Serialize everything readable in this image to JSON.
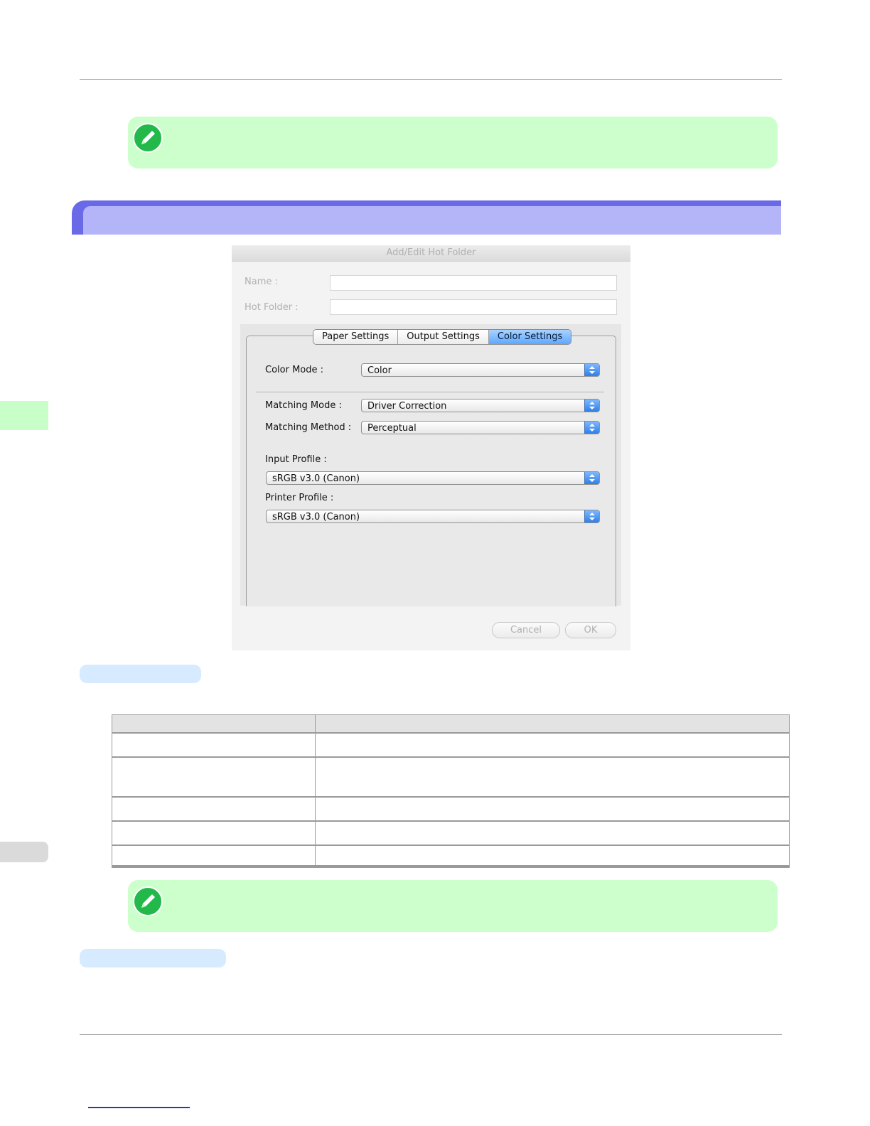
{
  "dialog": {
    "title": "Add/Edit Hot Folder",
    "name_label": "Name :",
    "hot_folder_label": "Hot Folder :",
    "name_value": "",
    "hot_folder_value": "",
    "tabs": [
      {
        "label": "Paper Settings",
        "active": false
      },
      {
        "label": "Output Settings",
        "active": false
      },
      {
        "label": "Color Settings",
        "active": true
      }
    ],
    "color_mode_label": "Color Mode :",
    "color_mode_value": "Color",
    "matching_mode_label": "Matching Mode :",
    "matching_mode_value": "Driver Correction",
    "matching_method_label": "Matching Method :",
    "matching_method_value": "Perceptual",
    "input_profile_label": "Input Profile :",
    "input_profile_value": "sRGB v3.0 (Canon)",
    "printer_profile_label": "Printer Profile :",
    "printer_profile_value": "sRGB v3.0 (Canon)",
    "cancel_label": "Cancel",
    "ok_label": "OK"
  },
  "colors": {
    "note_bg": "#ccffcc",
    "section_bar": "#6a6ae8",
    "section_bar_inner": "#b4b4f8",
    "subheading_bg": "#d6ebff",
    "active_tab": "#5ea9ff"
  },
  "icons": {
    "note": "pencil-note-icon",
    "select_arrows": "up-down-arrows-icon"
  }
}
